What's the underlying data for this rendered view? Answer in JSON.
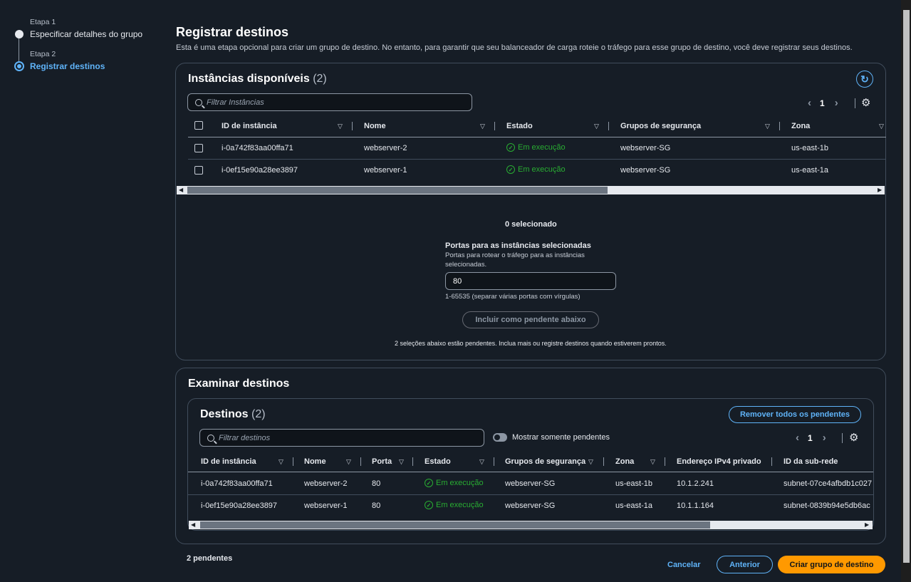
{
  "steps": [
    {
      "label": "Etapa 1",
      "title": "Especificar detalhes do grupo",
      "active": false
    },
    {
      "label": "Etapa 2",
      "title": "Registrar destinos",
      "active": true
    }
  ],
  "page": {
    "title": "Registrar destinos",
    "description": "Esta é uma etapa opcional para criar um grupo de destino. No entanto, para garantir que seu balanceador de carga roteie o tráfego para esse grupo de destino, você deve registrar seus destinos."
  },
  "available": {
    "title": "Instâncias disponíveis",
    "count": "(2)",
    "search_placeholder": "Filtrar Instâncias",
    "page": "1",
    "columns": [
      "ID de instância",
      "Nome",
      "Estado",
      "Grupos de segurança",
      "Zona"
    ],
    "rows": [
      {
        "id": "i-0a742f83aa00ffa71",
        "name": "webserver-2",
        "state": "Em execução",
        "sg": "webserver-SG",
        "zone": "us-east-1b"
      },
      {
        "id": "i-0ef15e90a28ee3897",
        "name": "webserver-1",
        "state": "Em execução",
        "sg": "webserver-SG",
        "zone": "us-east-1a"
      }
    ],
    "selected": "0 selecionado",
    "ports_label": "Portas para as instâncias selecionadas",
    "ports_desc": "Portas para rotear o tráfego para as instâncias selecionadas.",
    "ports_value": "80",
    "ports_hint": "1-65535 (separar várias portas com vírgulas)",
    "include_button": "Incluir como pendente abaixo",
    "pending_note": "2 seleções abaixo estão pendentes. Inclua mais ou registre destinos quando estiverem prontos."
  },
  "review": {
    "title": "Examinar destinos",
    "targets_title": "Destinos",
    "count": "(2)",
    "remove_button": "Remover todos os pendentes",
    "search_placeholder": "Filtrar destinos",
    "toggle_label": "Mostrar somente pendentes",
    "page": "1",
    "columns": [
      "ID de instância",
      "Nome",
      "Porta",
      "Estado",
      "Grupos de segurança",
      "Zona",
      "Endereço IPv4 privado",
      "ID da sub-rede"
    ],
    "rows": [
      {
        "id": "i-0a742f83aa00ffa71",
        "name": "webserver-2",
        "port": "80",
        "state": "Em execução",
        "sg": "webserver-SG",
        "zone": "us-east-1b",
        "ip": "10.1.2.241",
        "subnet": "subnet-07ce4afbdb1c027"
      },
      {
        "id": "i-0ef15e90a28ee3897",
        "name": "webserver-1",
        "port": "80",
        "state": "Em execução",
        "sg": "webserver-SG",
        "zone": "us-east-1a",
        "ip": "10.1.1.164",
        "subnet": "subnet-0839b94e5db6ac"
      }
    ]
  },
  "footer": {
    "pending": "2 pendentes",
    "cancel": "Cancelar",
    "previous": "Anterior",
    "create": "Criar grupo de destino"
  },
  "colors": {
    "accent": "#5fb3f8",
    "primary": "#ff9900",
    "success": "#29ad32"
  }
}
